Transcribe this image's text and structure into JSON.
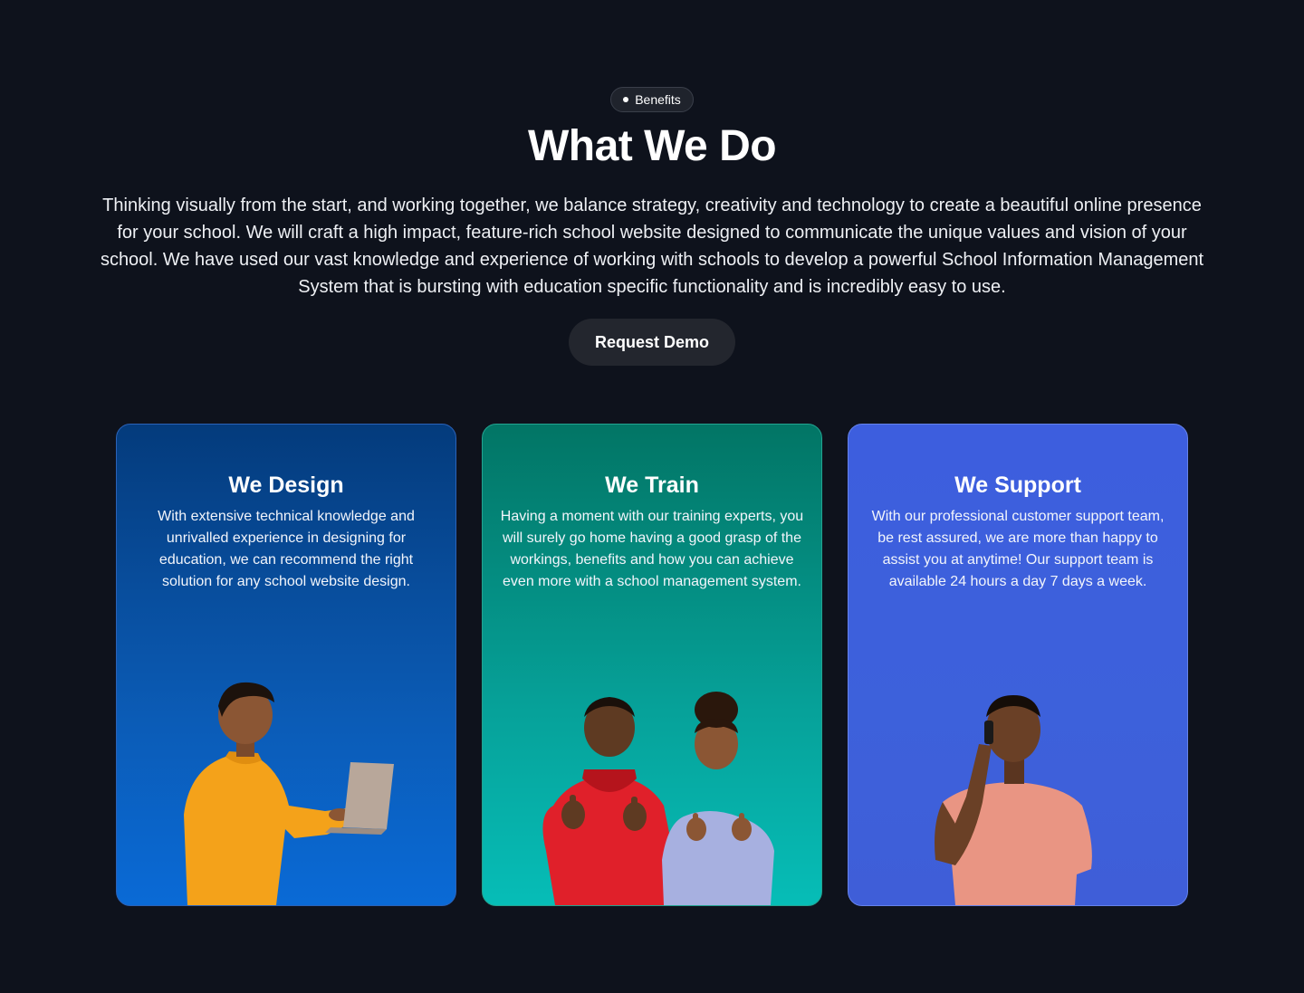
{
  "badge": {
    "label": "Benefits"
  },
  "hero": {
    "title": "What We Do",
    "description": "Thinking visually from the start, and working together, we balance strategy, creativity and technology to create a beautiful online presence for your school. We will craft a high impact, feature-rich school website designed to communicate the unique values and vision of your school. We have used our vast knowledge and experience of working with schools to develop a powerful School Information Management System that is bursting with education specific functionality and is incredibly easy to use.",
    "cta_label": "Request Demo"
  },
  "cards": [
    {
      "title": "We Design",
      "text": "With extensive technical knowledge and unrivalled experience in designing for education, we can recommend the right solution for any school website design."
    },
    {
      "title": "We Train",
      "text": "Having a moment with our training experts, you will surely go home having a good grasp of the workings, benefits and how you can achieve even more with a school management system."
    },
    {
      "title": "We Support",
      "text": "With our professional customer support team, be rest assured, we are more than happy to assist you at anytime! Our support team is available 24 hours a day 7 days a week."
    }
  ]
}
